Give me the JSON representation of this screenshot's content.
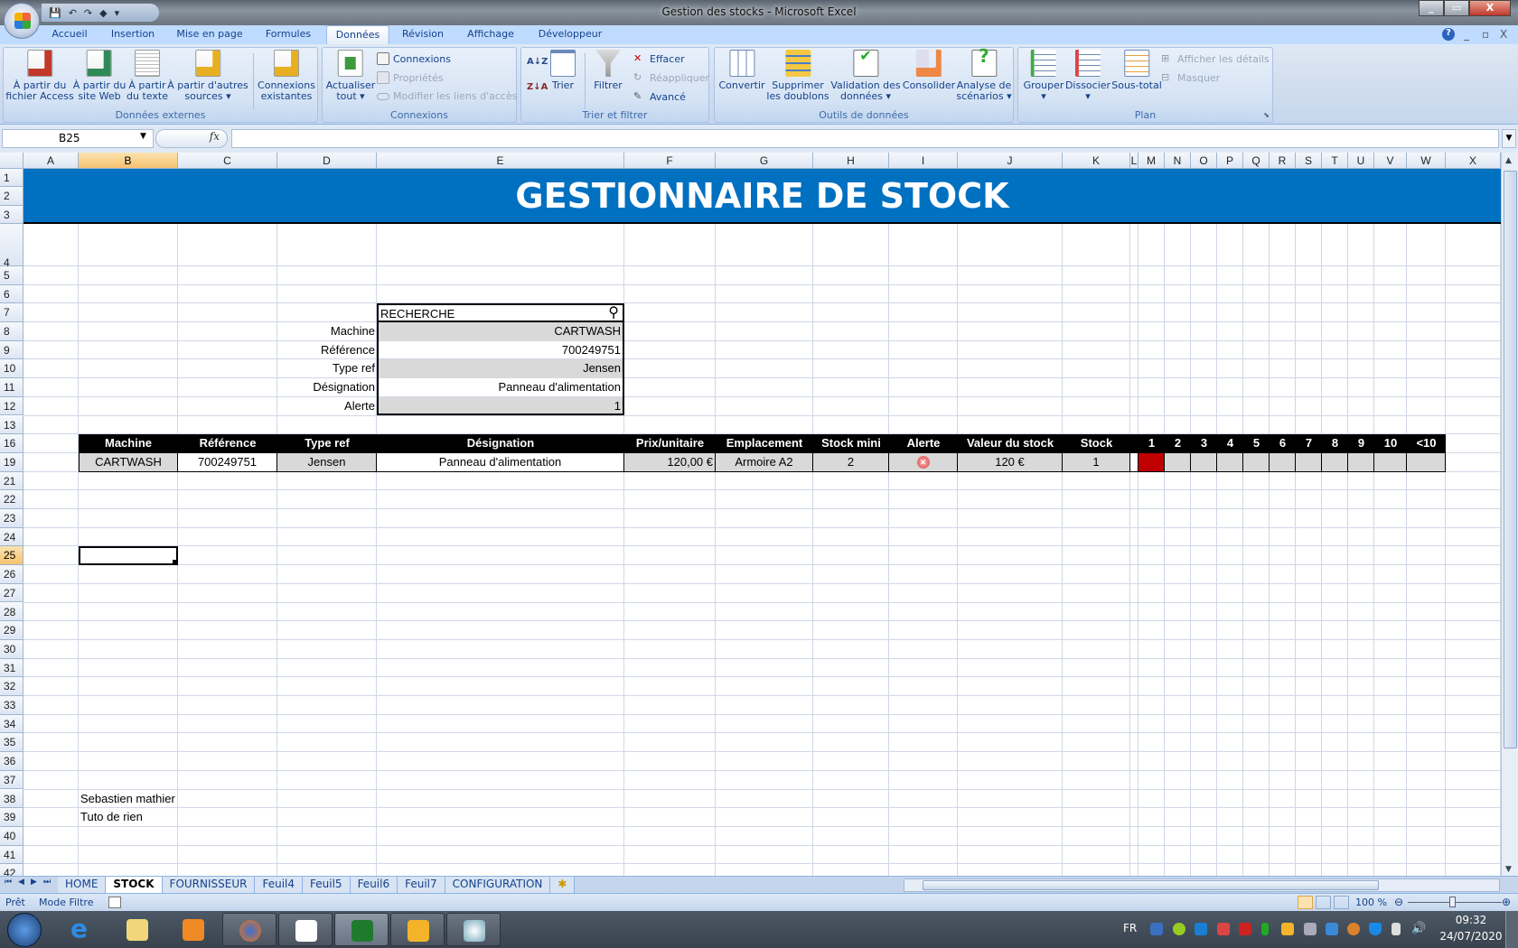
{
  "window": {
    "title": "Gestion des stocks - Microsoft Excel",
    "min": "_",
    "restore": "▭",
    "close": "X"
  },
  "qat": {
    "save": "💾",
    "undo": "↶",
    "redo": "↷",
    "fill": "◆",
    "more": "▾"
  },
  "ribbon_tabs": [
    "Accueil",
    "Insertion",
    "Mise en page",
    "Formules",
    "Données",
    "Révision",
    "Affichage",
    "Développeur"
  ],
  "active_tab": "Données",
  "mdi": {
    "help": "?",
    "min": "_",
    "restore": "▫",
    "close": "X"
  },
  "ribbon": {
    "groups": {
      "external": {
        "label": "Données externes",
        "access": [
          "À partir du",
          "fichier Access"
        ],
        "web": [
          "À partir du",
          "site Web"
        ],
        "text": [
          "À partir",
          "du texte"
        ],
        "other": [
          "À partir d'autres",
          "sources ▾"
        ],
        "existing": [
          "Connexions",
          "existantes"
        ]
      },
      "connections": {
        "label": "Connexions",
        "refresh": [
          "Actualiser",
          "tout ▾"
        ],
        "connections": "Connexions",
        "properties": "Propriétés",
        "edit_links": "Modifier les liens d'accès"
      },
      "sort": {
        "label": "Trier et filtrer",
        "sort_az": "A↓Z",
        "sort_za": "Z↓A",
        "sort": "Trier",
        "filter": "Filtrer",
        "clear": "Effacer",
        "reapply": "Réappliquer",
        "advanced": "Avancé"
      },
      "tools": {
        "label": "Outils de données",
        "convert": [
          "Convertir",
          ""
        ],
        "dedupe": [
          "Supprimer",
          "les doublons"
        ],
        "validation": [
          "Validation des",
          "données ▾"
        ],
        "consolidate": [
          "Consolider",
          ""
        ],
        "whatif": [
          "Analyse de",
          "scénarios ▾"
        ]
      },
      "outline": {
        "label": "Plan",
        "group": [
          "Grouper",
          "▾"
        ],
        "ungroup": [
          "Dissocier",
          "▾"
        ],
        "subtotal": [
          "Sous-total",
          ""
        ],
        "show": "Afficher les détails",
        "hide": "Masquer"
      }
    }
  },
  "formula_bar": {
    "name_box": "B25",
    "fx": "fx",
    "formula": ""
  },
  "sheet": {
    "columns": [
      "A",
      "B",
      "C",
      "D",
      "E",
      "F",
      "G",
      "H",
      "I",
      "J",
      "K",
      "L",
      "M",
      "N",
      "O",
      "P",
      "Q",
      "R",
      "S",
      "T",
      "U",
      "V",
      "W",
      "X"
    ],
    "rows": [
      "1",
      "2",
      "3",
      "4",
      "5",
      "6",
      "7",
      "8",
      "9",
      "10",
      "11",
      "12",
      "13",
      "16",
      "19",
      "21",
      "22",
      "23",
      "24",
      "25",
      "26",
      "27",
      "28",
      "29",
      "30",
      "31",
      "32",
      "33",
      "34",
      "35",
      "36",
      "37",
      "38",
      "39",
      "40",
      "41",
      "42"
    ],
    "selected_cell": "B25",
    "banner": "GESTIONNAIRE DE STOCK",
    "search": {
      "title": "RECHERCHE",
      "fields": [
        {
          "label": "Machine",
          "value": "CARTWASH"
        },
        {
          "label": "Référence",
          "value": "700249751"
        },
        {
          "label": "Type ref",
          "value": "Jensen"
        },
        {
          "label": "Désignation",
          "value": "Panneau d'alimentation"
        },
        {
          "label": "Alerte",
          "value": "1"
        }
      ]
    },
    "table": {
      "headers": [
        "Machine",
        "Référence",
        "Type ref",
        "Désignation",
        "Prix/unitaire",
        "Emplacement",
        "Stock mini",
        "Alerte",
        "Valeur du stock",
        "Stock",
        "1",
        "2",
        "3",
        "4",
        "5",
        "6",
        "7",
        "8",
        "9",
        "10",
        "<10"
      ],
      "row": [
        "CARTWASH",
        "700249751",
        "Jensen",
        "Panneau d'alimentation",
        "120,00 €",
        "Armoire A2",
        "2",
        "✕",
        "120 €",
        "1"
      ],
      "stock_bar_filled": 1,
      "alert_color": "#c00000"
    },
    "notes": [
      "Sebastien mathier",
      "Tuto de rien"
    ],
    "banner_color": "#0070c0"
  },
  "sheet_tabs": [
    "HOME",
    "STOCK",
    "FOURNISSEUR",
    "Feuil4",
    "Feuil5",
    "Feuil6",
    "Feuil7",
    "CONFIGURATION"
  ],
  "active_sheet": "STOCK",
  "status": {
    "ready": "Prêt",
    "mode": "Mode Filtre",
    "zoom": "100 %"
  },
  "taskbar": {
    "lang": "FR",
    "time": "09:32",
    "date": "24/07/2020"
  }
}
